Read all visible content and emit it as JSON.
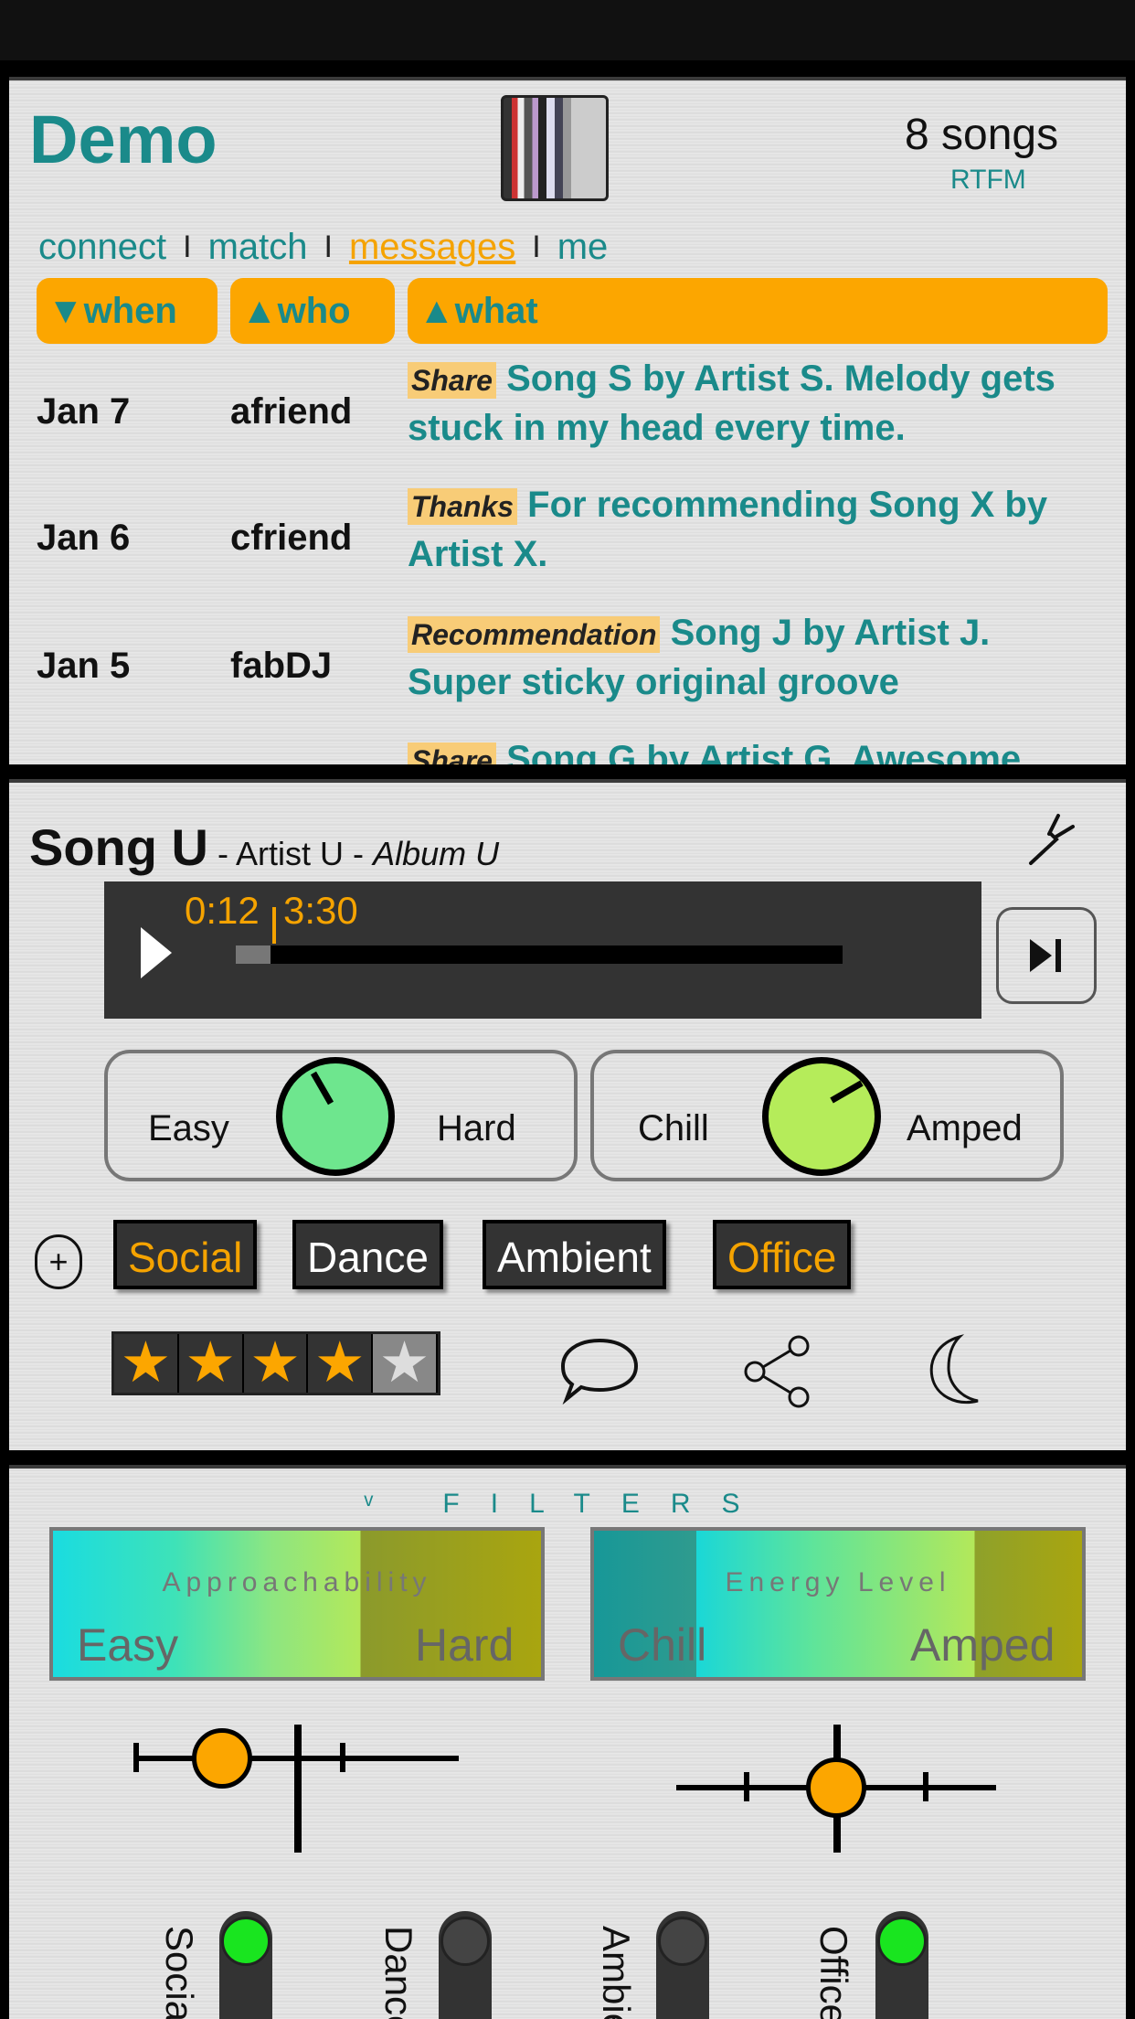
{
  "header": {
    "title": "Demo",
    "song_count": "8 songs",
    "rtfm": "RTFM"
  },
  "nav": {
    "items": [
      "connect",
      "match",
      "messages",
      "me"
    ],
    "separator": "I",
    "active": "messages"
  },
  "table": {
    "columns": [
      "▼when",
      "▲who",
      "▲what"
    ],
    "rows": [
      {
        "date": "Jan 7",
        "who": "afriend",
        "tag": "Share",
        "text": "Song S by Artist S. Melody gets stuck in my head every time."
      },
      {
        "date": "Jan 6",
        "who": "cfriend",
        "tag": "Thanks",
        "text": "For recommending Song X by Artist X."
      },
      {
        "date": "Jan 5",
        "who": "fabDJ",
        "tag": "Recommendation",
        "text": "Song J by Artist J. Super sticky original groove"
      },
      {
        "date": "",
        "who": "",
        "tag": "Share",
        "text": "Song G by Artist G. Awesome"
      }
    ]
  },
  "now_playing": {
    "song": "Song U",
    "sep": "-",
    "artist": "Artist U",
    "album": "Album U",
    "elapsed": "0:12",
    "total": "3:30",
    "progress": 0.057
  },
  "knobs": [
    {
      "left": "Easy",
      "right": "Hard",
      "color": "#6ee68e"
    },
    {
      "left": "Chill",
      "right": "Amped",
      "color": "#b5ec5a"
    }
  ],
  "tags": [
    {
      "label": "Social",
      "color": "#f5a300"
    },
    {
      "label": "Dance",
      "color": "#ffffff"
    },
    {
      "label": "Ambient",
      "color": "#ffffff"
    },
    {
      "label": "Office",
      "color": "#f5a300"
    }
  ],
  "plus": "+",
  "rating": {
    "value": 4,
    "max": 5,
    "star": "★"
  },
  "filters": {
    "title": "ᵛ FILTERS",
    "approachability": {
      "title": "Approachability",
      "left": "Easy",
      "right": "Hard"
    },
    "energy": {
      "title": "Energy Level",
      "left": "Chill",
      "right": "Amped"
    }
  },
  "toggles": [
    {
      "label": "Social",
      "on": true
    },
    {
      "label": "Dance",
      "on": false
    },
    {
      "label": "Ambient",
      "on": false
    },
    {
      "label": "Office",
      "on": true
    }
  ],
  "colors": {
    "teal": "#1a8a8a",
    "orange": "#fca600",
    "green": "#19e51f"
  }
}
